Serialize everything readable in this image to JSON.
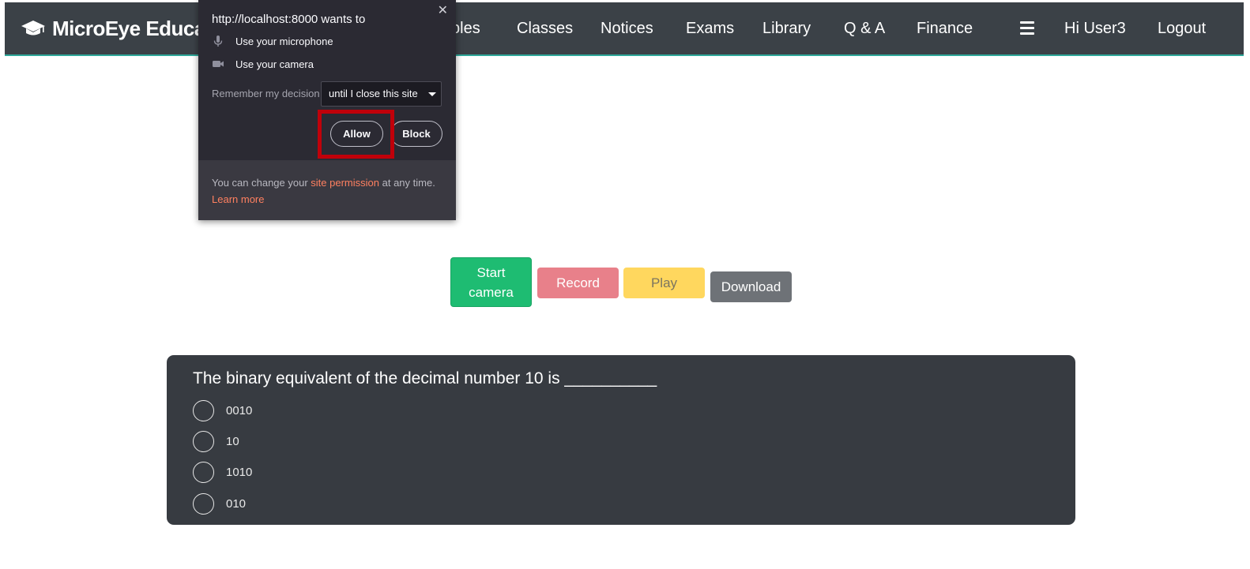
{
  "navbar": {
    "brand": "MicroEye Educat",
    "links": [
      "bles",
      "Classes",
      "Notices",
      "Exams",
      "Library",
      "Q & A",
      "Finance"
    ],
    "greeting": "Hi User3",
    "logout": "Logout"
  },
  "permission_popup": {
    "title": "http://localhost:8000 wants to",
    "microphone": "Use your microphone",
    "camera": "Use your camera",
    "remember_label": "Remember my decision",
    "remember_value": "until I close this site",
    "allow": "Allow",
    "block": "Block",
    "footer_prefix": "You can change your ",
    "footer_link": "site permission",
    "footer_suffix": " at any time.",
    "learn_more": "Learn more"
  },
  "camera_controls": {
    "start_line1": "Start",
    "start_line2": "camera",
    "record": "Record",
    "play": "Play",
    "download": "Download"
  },
  "quiz": {
    "question": "The binary equivalent of the decimal number 10 is __________",
    "options": [
      "0010",
      "10",
      "1010",
      "010"
    ]
  },
  "colors": {
    "navbar_bg": "#3b4147",
    "popup_bg": "#2b2a33",
    "highlight": "#c0000a",
    "start": "#1ebc72",
    "record": "#e8808a",
    "play": "#ffd75e",
    "download": "#6e7277",
    "card_bg": "#373b41"
  }
}
